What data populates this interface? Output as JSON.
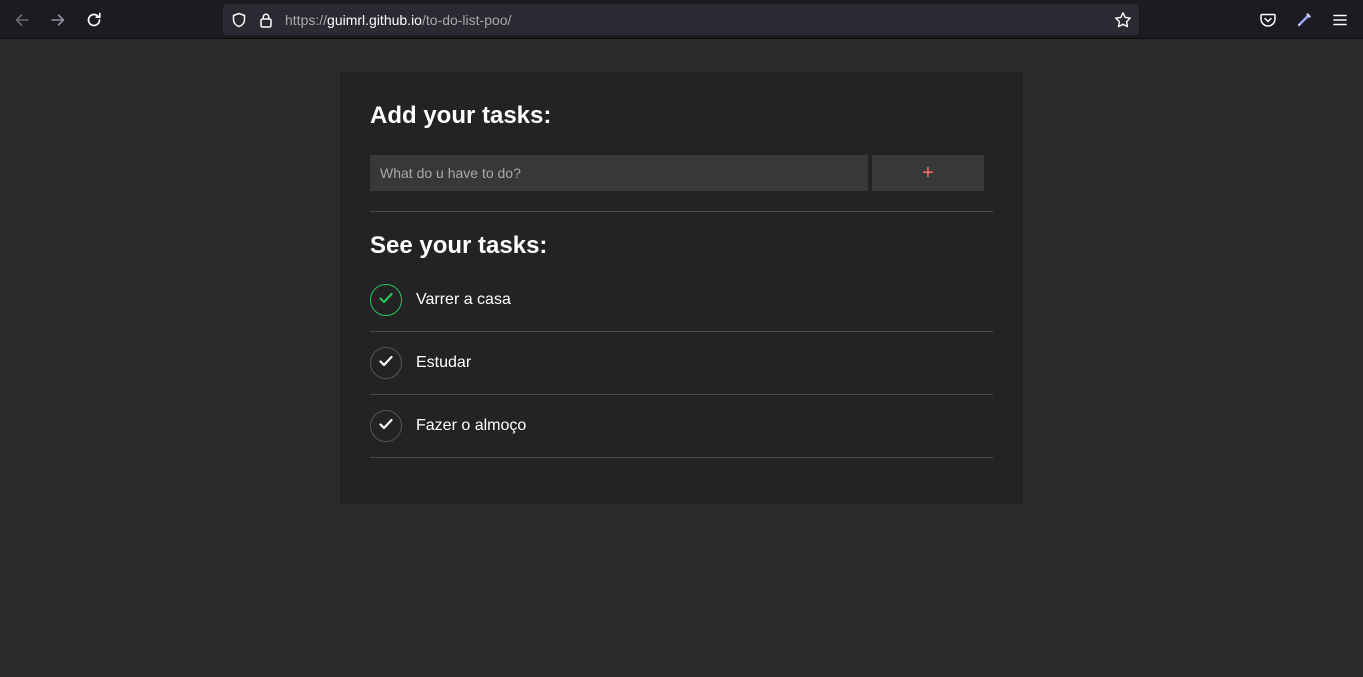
{
  "browser": {
    "url_scheme": "https://",
    "url_host": "guimrl.github.io",
    "url_path": "/to-do-list-poo/",
    "icons": {
      "back": "back-arrow-icon",
      "forward": "forward-arrow-icon",
      "reload": "reload-icon",
      "tracking_protection": "shield-icon",
      "security": "lock-icon",
      "bookmark": "star-icon",
      "pocket": "pocket-icon",
      "extension": "pen-icon",
      "menu": "hamburger-menu-icon"
    }
  },
  "app": {
    "add_heading": "Add your tasks:",
    "input_placeholder": "What do u have to do?",
    "input_value": "",
    "add_button_label": "+",
    "list_heading": "See your tasks:",
    "tasks": [
      {
        "text": "Varrer a casa",
        "done": true
      },
      {
        "text": "Estudar",
        "done": false
      },
      {
        "text": "Fazer o almoço",
        "done": false
      }
    ]
  },
  "colors": {
    "page_background": "#2b2b2b",
    "card_background": "#232323",
    "accent_plus": "#ff6b6b",
    "done_check": "#22c55e"
  }
}
